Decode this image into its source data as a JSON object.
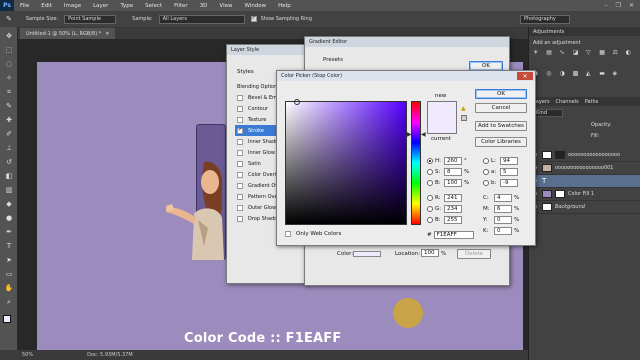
{
  "app": {
    "logo": "Ps"
  },
  "menu": [
    "File",
    "Edit",
    "Image",
    "Layer",
    "Type",
    "Select",
    "Filter",
    "3D",
    "View",
    "Window",
    "Help"
  ],
  "window_controls": [
    "–",
    "❐",
    "✕"
  ],
  "options": {
    "sample_size_label": "Sample Size:",
    "sample_size_value": "Point Sample",
    "sample_label": "Sample:",
    "sample_value": "All Layers",
    "show_ring_label": "Show Sampling Ring",
    "workspace": "Photography"
  },
  "document": {
    "tab": "Untitled-1 @ 50% (L, RGB/8) *",
    "zoom": "50%",
    "doc_size": "Doc: 5.93M/5.37M"
  },
  "caption": "Color Code :: F1EAFF",
  "layer_style": {
    "title": "Layer Style",
    "styles_header": "Styles",
    "items": [
      "Blending Options",
      "Bevel & Emboss",
      "Contour",
      "Texture",
      "Stroke",
      "Inner Shadow",
      "Inner Glow",
      "Satin",
      "Color Overlay",
      "Gradient Overlay",
      "Pattern Overlay",
      "Outer Glow",
      "Drop Shadow"
    ],
    "checked": [
      false,
      false,
      false,
      false,
      true,
      false,
      false,
      false,
      false,
      false,
      false,
      false,
      false
    ],
    "selected_index": 4
  },
  "gradient_editor": {
    "title": "Gradient Editor",
    "presets_label": "Presets",
    "ok": "OK",
    "color_label": "Color:",
    "location_label": "Location:",
    "location_value": "100",
    "location_unit": "%",
    "delete_label": "Delete"
  },
  "color_picker": {
    "title": "Color Picker (Stop Color)",
    "ok": "OK",
    "cancel": "Cancel",
    "add_to_swatches": "Add to Swatches",
    "color_libraries": "Color Libraries",
    "new_label": "new",
    "current_label": "current",
    "only_web_colors": "Only Web Colors",
    "new_color": "#F1EAFF",
    "current_color": "#F1EAFF",
    "fields": {
      "H": "260",
      "H_unit": "°",
      "S": "8",
      "S_unit": "%",
      "B": "100",
      "B_unit": "%",
      "R": "241",
      "G": "234",
      "B2": "255",
      "L": "94",
      "a": "5",
      "b": "-9",
      "C": "4",
      "M": "6",
      "Y": "0",
      "K": "0",
      "pct": "%",
      "hex": "F1EAFF"
    }
  },
  "panels": {
    "adjustments_tab": "Adjustments",
    "add_adjustment": "Add an adjustment",
    "layer_tabs": [
      "Layers",
      "Channels",
      "Paths"
    ],
    "kind_label": "Kind",
    "opacity_label": "Opacity:",
    "fill_label": "Fill:",
    "layers": [
      {
        "name": "ooooooooooooooooo"
      },
      {
        "name": "oooooooooooooooo001"
      },
      {
        "name": ""
      },
      {
        "name": "Color Fill 1"
      },
      {
        "name": "Background"
      }
    ]
  },
  "colors": {
    "canvas": "#9c8bbd",
    "picked": "#F1EAFF",
    "hue_pure": "#5500ff"
  }
}
